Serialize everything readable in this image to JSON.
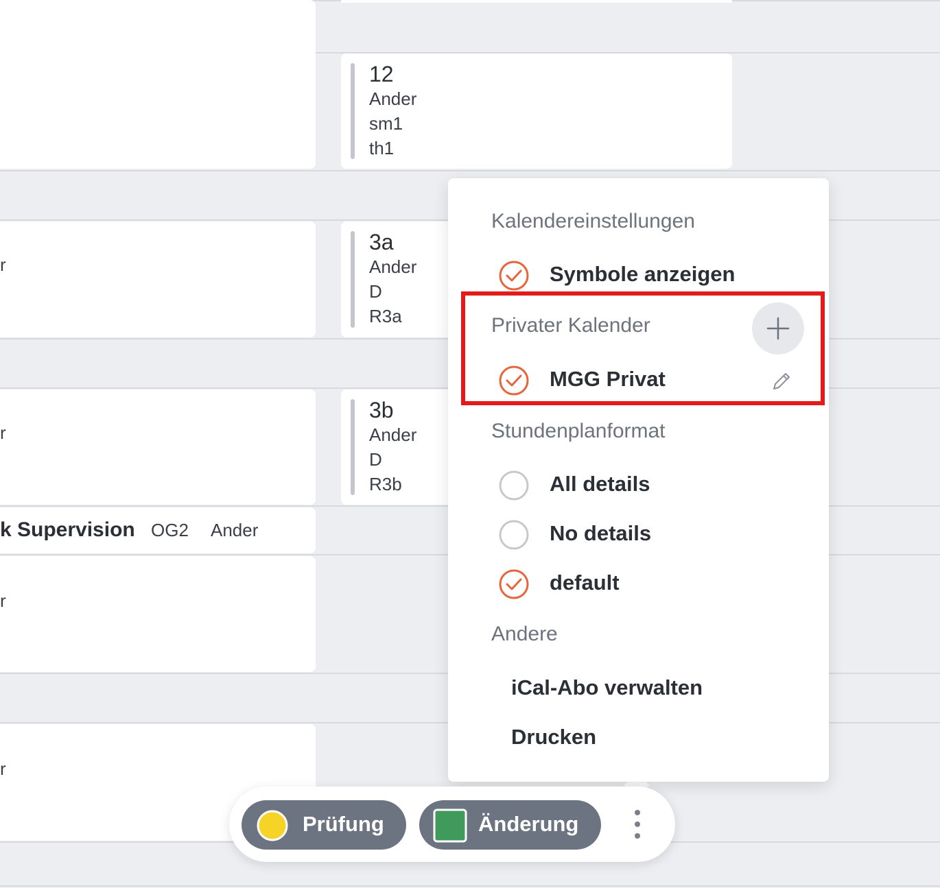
{
  "calendar": {
    "lessons": [
      {
        "title": "12",
        "lines": [
          "Ander",
          "sm1",
          "th1"
        ]
      },
      {
        "title": "3a",
        "lines": [
          "Ander",
          "D",
          "R3a"
        ]
      },
      {
        "title": "3b",
        "lines": [
          "Ander",
          "D",
          "R3b"
        ]
      }
    ],
    "edge_letters": [
      "r",
      "r",
      "r",
      "r"
    ],
    "supervision": {
      "title": "k Supervision",
      "room": "OG2",
      "teacher": "Ander"
    }
  },
  "menu": {
    "sections": {
      "calendar_settings": "Kalendereinstellungen",
      "private_calendar": "Privater Kalender",
      "timetable_format": "Stundenplanformat",
      "other": "Andere"
    },
    "options": {
      "show_symbols": {
        "label": "Symbole anzeigen",
        "checked": true
      },
      "mgg_privat": {
        "label": "MGG Privat",
        "checked": true
      },
      "all_details": {
        "label": "All details",
        "checked": false
      },
      "no_details": {
        "label": "No details",
        "checked": false
      },
      "default": {
        "label": "default",
        "checked": true
      }
    },
    "links": {
      "ical": "iCal-Abo verwalten",
      "print": "Drucken"
    },
    "icons": {
      "add": "plus-icon",
      "edit": "pencil-icon",
      "checked": "check-circle-icon",
      "unchecked": "empty-circle-icon"
    }
  },
  "legend": {
    "items": [
      {
        "label": "Prüfung",
        "color": "#f5d327",
        "shape": "circle"
      },
      {
        "label": "Änderung",
        "color": "#3f9a5b",
        "shape": "square"
      }
    ],
    "more_icon": "more-vertical-icon"
  },
  "colors": {
    "accent": "#e8643a",
    "highlight": "#e31b1b",
    "pill": "#6b7480"
  }
}
